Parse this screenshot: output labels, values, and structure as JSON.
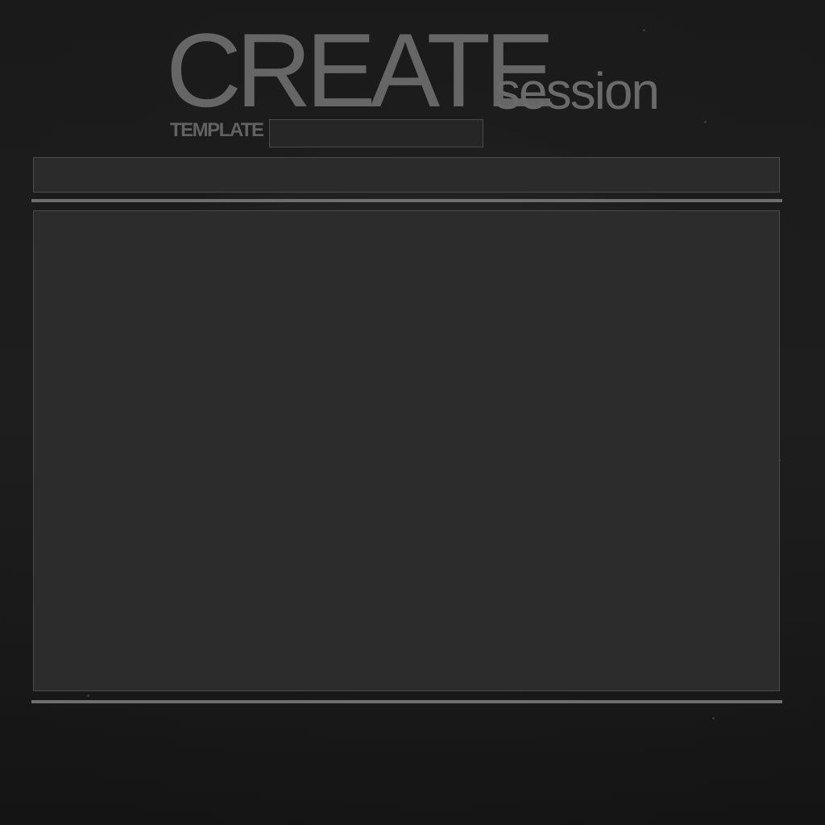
{
  "header": {
    "title_main": "CREATE",
    "title_sub": "session"
  },
  "template": {
    "label": "TEMPLATE",
    "value": ""
  },
  "top_bar": {
    "value": ""
  },
  "main_panel": {
    "value": ""
  },
  "colors": {
    "background": "#161616",
    "title_text": "#666666",
    "field_background": "#2b2b2b",
    "field_border": "#4c4c4c",
    "divider": "#6e6e6e"
  }
}
